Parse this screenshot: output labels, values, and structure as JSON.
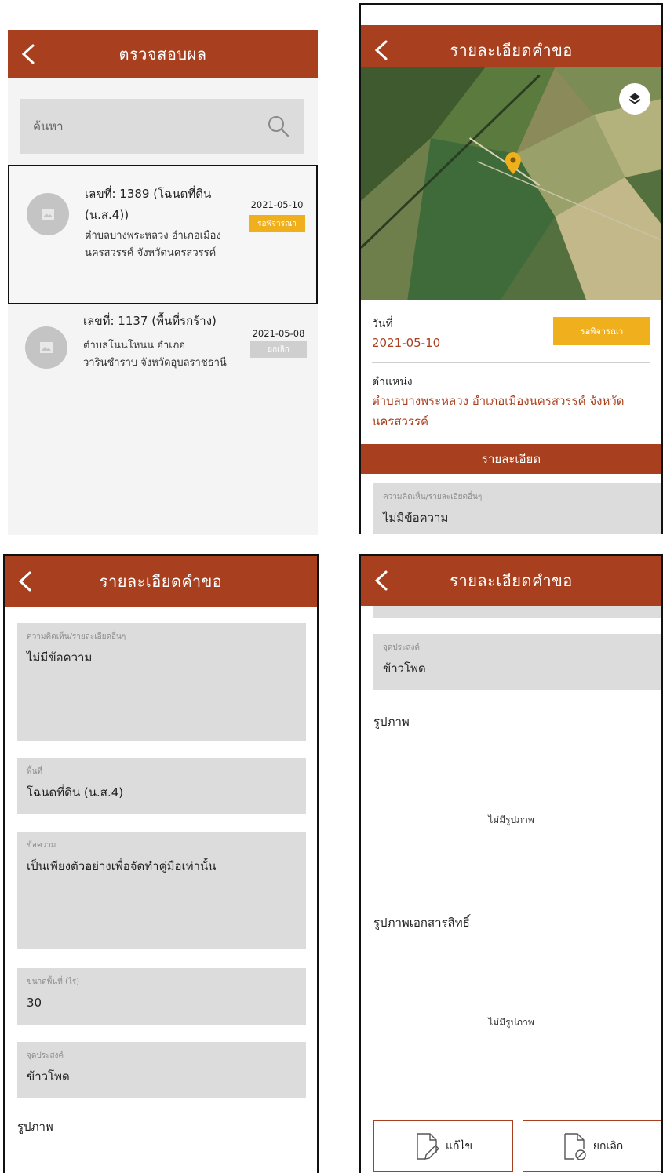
{
  "list_screen": {
    "title": "ตรวจสอบผล",
    "search": {
      "placeholder": "ค้นหา",
      "icon": "search-icon"
    },
    "rows": [
      {
        "title": "เลขที่: 1389 (โฉนดที่ดิน (น.ส.4))",
        "location": "ตำบลบางพระหลวง อำเภอเมืองนครสวรรค์ จังหวัดนครสวรรค์",
        "date": "2021-05-10",
        "status": "รอพิจารณา"
      },
      {
        "title": "เลขที่: 1137 (พื้นที่รกร้าง)",
        "location": "ตำบลโนนโหนน อำเภอวารินชำราบ จังหวัดอุบลราชธานี",
        "date": "2021-05-08",
        "status": "ยกเลิก"
      }
    ]
  },
  "detail_screen": {
    "title": "รายละเอียดคำขอ",
    "date_label": "วันที่",
    "date_value": "2021-05-10",
    "status": "รอพิจารณา",
    "position_label": "ตำแหน่ง",
    "position_value": "ตำบลบางพระหลวง อำเภอเมืองนครสวรรค์ จังหวัดนครสวรรค์",
    "section_title": "รายละเอียด",
    "comment_label": "ความคิดเห็น/รายละเอียดอื่นๆ",
    "comment_value": "ไม่มีข้อความ"
  },
  "detail_screen_2": {
    "title": "รายละเอียดคำขอ",
    "fields": [
      {
        "label": "ความคิดเห็น/รายละเอียดอื่นๆ",
        "value": "ไม่มีข้อความ"
      },
      {
        "label": "พื้นที่",
        "value": "โฉนดที่ดิน (น.ส.4)"
      },
      {
        "label": "ข้อความ",
        "value": "เป็นเพียงตัวอย่างเพื่อจัดทำคู่มือเท่านั้น"
      },
      {
        "label": "ขนาดพื้นที่ (ไร่)",
        "value": "30"
      },
      {
        "label": "จุดประสงค์",
        "value": "ข้าวโพด"
      }
    ],
    "photos_label": "รูปภาพ"
  },
  "detail_screen_3": {
    "title": "รายละเอียดคำขอ",
    "purpose_label": "จุดประสงค์",
    "purpose_value": "ข้าวโพด",
    "photos_label": "รูปภาพ",
    "photos_empty": "ไม่มีรูปภาพ",
    "doc_photos_label": "รูปภาพเอกสารสิทธิ์",
    "doc_photos_empty": "ไม่มีรูปภาพ",
    "edit_label": "แก้ไข",
    "cancel_label": "ยกเลิก"
  },
  "colors": {
    "accent": "#a8401f",
    "pending": "#f0b01e",
    "cancelled": "#cfcfcf",
    "field_bg": "#dcdcdc"
  }
}
